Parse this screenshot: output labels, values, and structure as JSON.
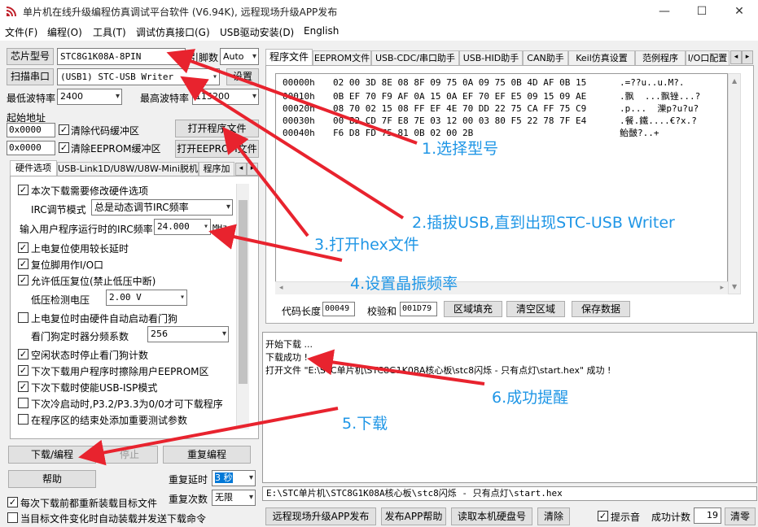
{
  "window": {
    "title": "单片机在线升级编程仿真调试平台软件 (V6.94K), 远程现场升级APP发布",
    "minimize": "—",
    "maximize": "☐",
    "close": "✕"
  },
  "menu": [
    "文件(F)",
    "编程(O)",
    "工具(T)",
    "调试仿真接口(G)",
    "USB驱动安装(D)",
    "English"
  ],
  "left": {
    "chip_btn": "芯片型号",
    "chip_value": "STC8G1K08A-8PIN",
    "pins_label": "引脚数",
    "pins_value": "Auto",
    "scan_btn": "扫描串口",
    "port_value": "(USB1) STC-USB Writer",
    "settings_btn": "设置",
    "min_baud_label": "最低波特率",
    "min_baud_value": "2400",
    "max_baud_label": "最高波特率",
    "max_baud_value": "115200",
    "start_addr_label": "起始地址",
    "addr1": "0x0000",
    "clear_code_label": "清除代码缓冲区",
    "open_prog_btn": "打开程序文件",
    "addr2": "0x0000",
    "clear_eeprom_label": "清除EEPROM缓冲区",
    "open_eeprom_btn": "打开EEPROM文件",
    "tabs": [
      "硬件选项",
      "USB-Link1D/U8W/U8W-Mini脱机",
      "程序加"
    ],
    "options": {
      "opt1": "本次下载需要修改硬件选项",
      "irc_mode_label": "IRC调节模式",
      "irc_mode_value": "总是动态调节IRC频率",
      "irc_freq_label": "输入用户程序运行时的IRC频率",
      "irc_freq_value": "24.000",
      "irc_freq_unit": "MHz",
      "opt2": "上电复位使用较长延时",
      "opt3": "复位脚用作I/O口",
      "opt4": "允许低压复位(禁止低压中断)",
      "lvd_label": "低压检测电压",
      "lvd_value": "2.00 V",
      "opt5": "上电复位时由硬件自动启动看门狗",
      "wdt_label": "看门狗定时器分频系数",
      "wdt_value": "256",
      "opt6": "空闲状态时停止看门狗计数",
      "opt7": "下次下载用户程序时擦除用户EEPROM区",
      "opt8": "下次下载时使能USB-ISP模式",
      "opt9": "下次冷启动时,P3.2/P3.3为0/0才可下载程序",
      "opt10": "在程序区的结束处添加重要测试参数"
    },
    "download_btn": "下载/编程",
    "stop_btn": "停止",
    "reprog_btn": "重复编程",
    "help_btn": "帮助",
    "delay_label": "重复延时",
    "delay_value": "3 秒",
    "count_label": "重复次数",
    "count_value": "无限",
    "reload_label": "每次下载前都重新装载目标文件",
    "auto_label": "当目标文件变化时自动装载并发送下载命令"
  },
  "right": {
    "tabs": [
      "程序文件",
      "EEPROM文件",
      "USB-CDC/串口助手",
      "USB-HID助手",
      "CAN助手",
      "Keil仿真设置",
      "范例程序",
      "I/O口配置"
    ],
    "hex_rows": [
      {
        "addr": "00000h",
        "bytes": "02 00 3D 8E 08 8F 09 75 0A 09 75 0B 4D AF 0B 15",
        "ascii": ".=??u..u.M?."
      },
      {
        "addr": "00010h",
        "bytes": "0B EF 70 F9 AF 0A 15 0A EF 70 EF E5 09 15 09 AE",
        "ascii": ".飘  ...飘锉...?"
      },
      {
        "addr": "00020h",
        "bytes": "08 70 02 15 08 FF EF 4E 70 DD 22 75 CA FF 75 C9",
        "ascii": ".p...  濼p?u?u?"
      },
      {
        "addr": "00030h",
        "bytes": "00 B2 CD 7F E8 7E 03 12 00 03 80 F5 22 78 7F E4",
        "ascii": ".餐.鐵....€?x.?"
      },
      {
        "addr": "00040h",
        "bytes": "F6 D8 FD 75 81 0B 02 00 2B",
        "ascii": "鲐皼?..+"
      }
    ],
    "code_len_label": "代码长度",
    "code_len_value": "00049",
    "checksum_label": "校验和",
    "checksum_value": "001D79",
    "fill_btn": "区域填充",
    "clear_btn": "清空区域",
    "save_btn": "保存数据",
    "log": [
      "开始下载 ...",
      "下载成功 !",
      "打开文件 \"E:\\STC单片机\\STC8G1K08A核心板\\stc8闪烁 - 只有点灯\\start.hex\" 成功 !"
    ],
    "path": "E:\\STC单片机\\STC8G1K08A核心板\\stc8闪烁 - 只有点灯\\start.hex",
    "publish_btn": "远程现场升级APP发布",
    "publish_help_btn": "发布APP帮助",
    "read_disk_btn": "读取本机硬盘号",
    "clear_log_btn": "清除",
    "tip_label": "提示音",
    "success_label": "成功计数",
    "success_value": "19",
    "clear_count_btn": "清零"
  },
  "annotations": {
    "step1": "1.选择型号",
    "step2": "2.插拔USB,直到出现STC-USB Writer",
    "step3": "3.打开hex文件",
    "step4": "4.设置晶振频率",
    "step5": "5.下载",
    "step6": "6.成功提醒",
    "arrow_color": "#e8232e",
    "text_color": "#1f96e6"
  }
}
